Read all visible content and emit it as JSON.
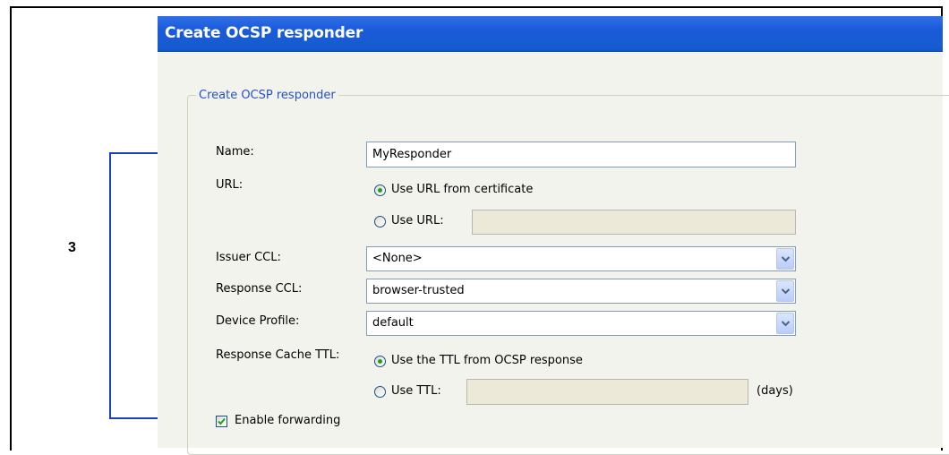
{
  "step_number": "3",
  "dialog": {
    "title": "Create OCSP responder",
    "group_title": "Create OCSP responder"
  },
  "form": {
    "name": {
      "label": "Name:",
      "value": "MyResponder"
    },
    "url": {
      "label": "URL:",
      "option_from_cert": "Use URL from certificate",
      "option_custom": "Use URL:",
      "custom_value": "",
      "selected": "Use URL from certificate"
    },
    "issuer_ccl": {
      "label": "Issuer CCL:",
      "value": "<None>"
    },
    "response_ccl": {
      "label": "Response CCL:",
      "value": "browser-trusted"
    },
    "device_profile": {
      "label": "Device Profile:",
      "value": "default"
    },
    "cache_ttl": {
      "label": "Response Cache TTL:",
      "option_from_response": "Use the TTL from OCSP response",
      "option_custom": "Use TTL:",
      "custom_value": "",
      "unit": "(days)",
      "selected": "Use the TTL from OCSP response"
    },
    "forwarding": {
      "label": "Enable forwarding",
      "checked": true
    }
  },
  "icons": {
    "dropdown": "chevron-down-icon",
    "checkmark": "checkmark-icon",
    "arrow": "arrow-right-icon"
  },
  "colors": {
    "titlebar": "#1a5ad9",
    "group_title": "#2850c8",
    "bracket": "#1c3fb5",
    "radio_dot": "#21a121",
    "dialog_bg": "#ece9d8"
  }
}
